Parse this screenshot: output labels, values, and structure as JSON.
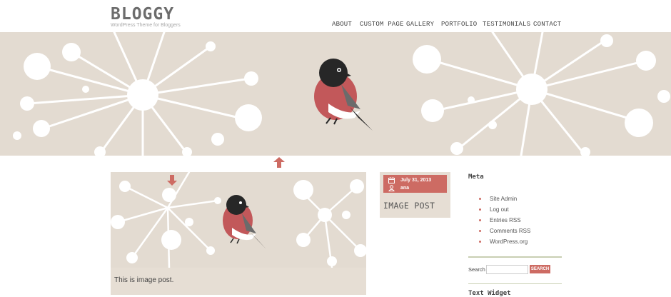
{
  "site": {
    "title": "BLOGGY",
    "tagline": "WordPress Theme for Bloggers"
  },
  "nav": {
    "items": [
      {
        "label": "ABOUT"
      },
      {
        "label": "CUSTOM PAGE"
      },
      {
        "label": "GALLERY"
      },
      {
        "label": "PORTFOLIO"
      },
      {
        "label": "TESTIMONIALS"
      },
      {
        "label": "CONTACT"
      }
    ]
  },
  "post": {
    "excerpt": "This is image post.",
    "date": "July 31, 2013",
    "author": "ana",
    "title": "IMAGE POST"
  },
  "sidebar": {
    "meta_heading": "Meta",
    "meta_items": [
      {
        "label": "Site Admin"
      },
      {
        "label": "Log out"
      },
      {
        "label": "Entries RSS"
      },
      {
        "label": "Comments RSS"
      },
      {
        "label": "WordPress.org"
      }
    ],
    "search_label": "Search",
    "search_value": "",
    "search_button": "SEARCH",
    "next_widget_heading": "Text Widget"
  },
  "colors": {
    "accent": "#cd6b63",
    "hero_bg": "#e3dbd1",
    "card_bg": "#e6ded4",
    "rule": "#c9cfb3"
  },
  "icons": {
    "calendar": "calendar-icon",
    "author": "user-icon",
    "up_arrow": "arrow-up-icon",
    "down_arrow": "arrow-down-icon"
  }
}
